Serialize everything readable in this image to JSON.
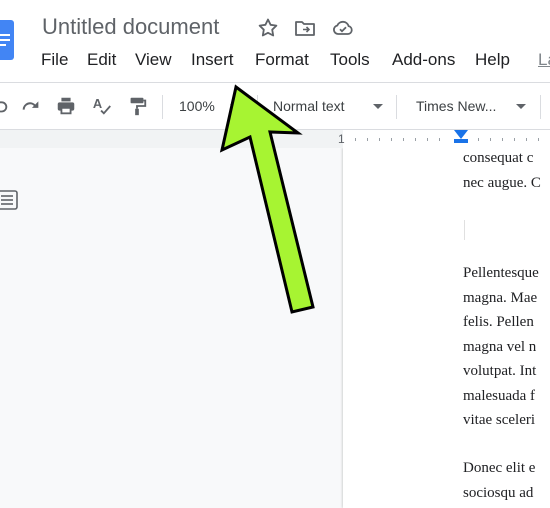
{
  "doc": {
    "title": "Untitled document"
  },
  "menu": {
    "items": [
      "File",
      "Edit",
      "View",
      "Insert",
      "Format",
      "Tools",
      "Add-ons",
      "Help",
      "La"
    ]
  },
  "toolbar": {
    "zoom": "100%",
    "style": "Normal text",
    "font": "Times New..."
  },
  "ruler": {
    "number": "1"
  },
  "paragraphs": [
    [
      "consequat c",
      "nec augue. C"
    ],
    [
      "Pellentesque",
      "magna. Mae",
      "felis. Pellen",
      "magna vel n",
      "volutpat. Int",
      "malesuada f",
      "vitae sceleri"
    ],
    [
      "Donec elit e",
      "sociosqu ad"
    ]
  ],
  "annotation": {
    "color": "#a7f432",
    "points_to": "Insert"
  }
}
